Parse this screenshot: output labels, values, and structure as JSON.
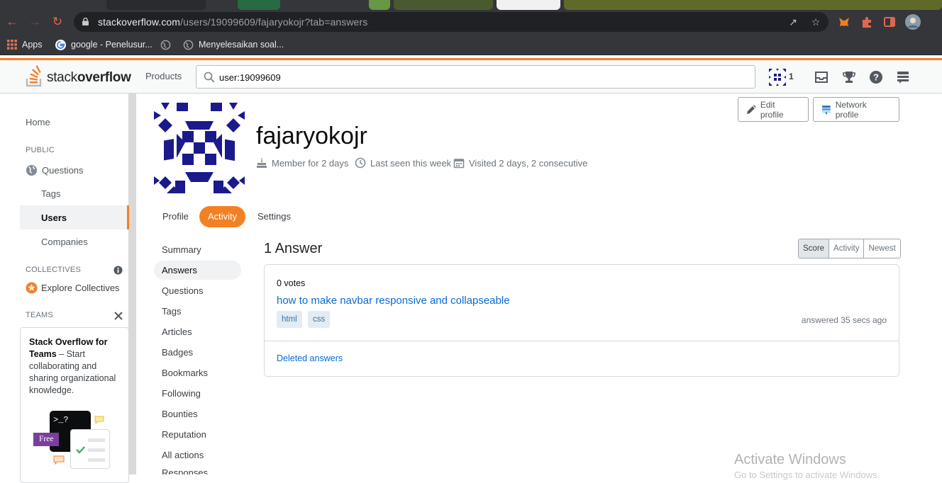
{
  "browser": {
    "url_host": "stackoverflow.com",
    "url_path": "/users/19099609/fajaryokojr?tab=answers",
    "bookmarks": [
      {
        "label": "Apps"
      },
      {
        "label": "google - Penelusur..."
      },
      {
        "label": ""
      },
      {
        "label": "Menyelesaikan soal..."
      }
    ]
  },
  "topbar": {
    "logo_stack": "stack",
    "logo_overflow": "overflow",
    "products": "Products",
    "search_value": "user:19099609",
    "reputation": "1"
  },
  "leftnav": {
    "home": "Home",
    "public_heading": "PUBLIC",
    "questions": "Questions",
    "tags": "Tags",
    "users": "Users",
    "companies": "Companies",
    "collectives_heading": "COLLECTIVES",
    "explore_collectives": "Explore Collectives",
    "teams_heading": "TEAMS",
    "teams_title": "Stack Overflow for Teams",
    "teams_body": " – Start collaborating and sharing organizational knowledge.",
    "free_badge": "Free",
    "terminal_text": ">_?"
  },
  "profile": {
    "username": "fajaryokojr",
    "member_for": "Member for 2 days",
    "last_seen": "Last seen this week",
    "visited": "Visited 2 days, 2 consecutive",
    "edit_profile": "Edit profile",
    "network_profile": "Network profile",
    "tabs": [
      {
        "label": "Profile",
        "active": false
      },
      {
        "label": "Activity",
        "active": true
      },
      {
        "label": "Settings",
        "active": false
      }
    ]
  },
  "activity_nav": [
    {
      "label": "Summary",
      "active": false
    },
    {
      "label": "Answers",
      "active": true
    },
    {
      "label": "Questions",
      "active": false
    },
    {
      "label": "Tags",
      "active": false
    },
    {
      "label": "Articles",
      "active": false
    },
    {
      "label": "Badges",
      "active": false
    },
    {
      "label": "Bookmarks",
      "active": false
    },
    {
      "label": "Following",
      "active": false
    },
    {
      "label": "Bounties",
      "active": false
    },
    {
      "label": "Reputation",
      "active": false
    },
    {
      "label": "All actions",
      "active": false
    },
    {
      "label": "Responses",
      "active": false
    }
  ],
  "answers": {
    "title": "1 Answer",
    "sort": [
      {
        "label": "Score",
        "active": true
      },
      {
        "label": "Activity",
        "active": false
      },
      {
        "label": "Newest",
        "active": false
      }
    ],
    "items": [
      {
        "votes": "0 votes",
        "title": "how to make navbar responsive and collapseable",
        "tags": [
          "html",
          "css"
        ],
        "when": "answered 35 secs ago"
      }
    ],
    "deleted_link": "Deleted answers"
  },
  "os": {
    "watermark": "Activate Windows",
    "watermark_sub": "Go to Settings to activate Windows."
  },
  "colors": {
    "accent": "#f48024",
    "link": "#0a6ad6",
    "tag_bg": "#e1ecf4",
    "tag_fg": "#39739d",
    "identicon": "#1a1a8c"
  }
}
